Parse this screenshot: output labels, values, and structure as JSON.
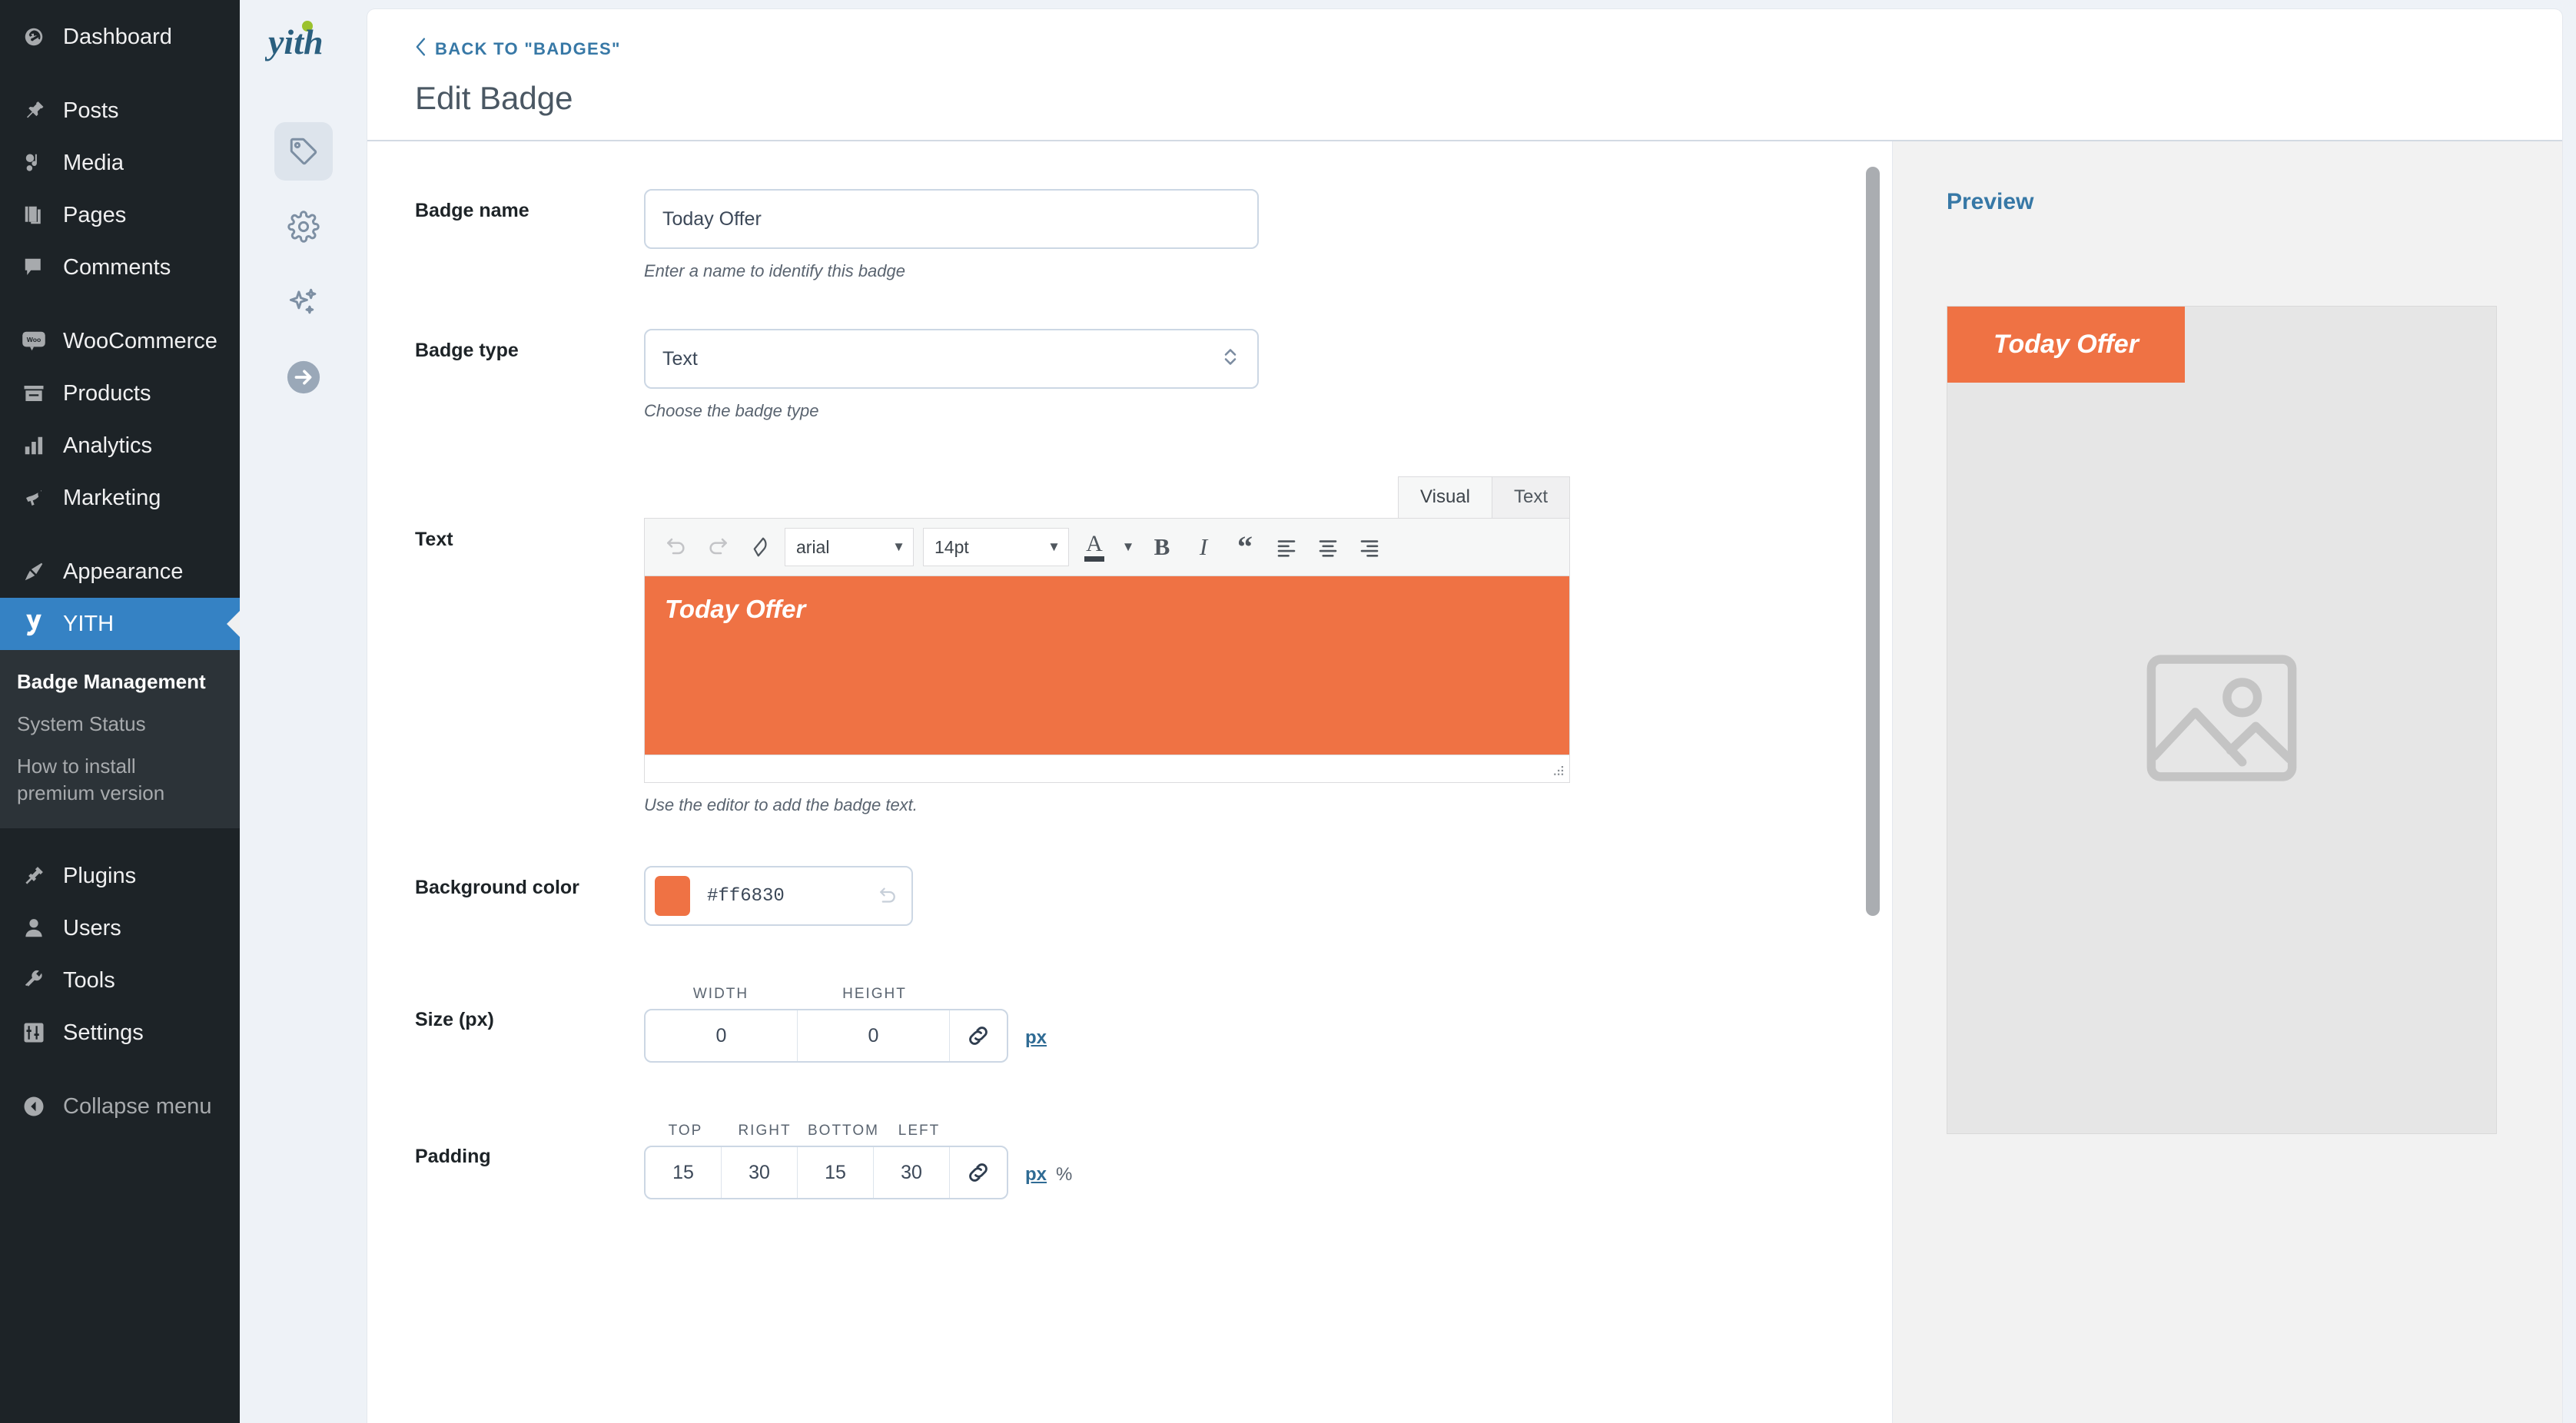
{
  "wp_sidebar": {
    "items": [
      {
        "label": "Dashboard",
        "icon": "dashboard-icon"
      },
      {
        "label": "Posts",
        "icon": "pin-icon"
      },
      {
        "label": "Media",
        "icon": "media-icon"
      },
      {
        "label": "Pages",
        "icon": "pages-icon"
      },
      {
        "label": "Comments",
        "icon": "comment-icon"
      },
      {
        "label": "WooCommerce",
        "icon": "woo-icon"
      },
      {
        "label": "Products",
        "icon": "products-icon"
      },
      {
        "label": "Analytics",
        "icon": "analytics-icon"
      },
      {
        "label": "Marketing",
        "icon": "megaphone-icon"
      },
      {
        "label": "Appearance",
        "icon": "brush-icon"
      },
      {
        "label": "YITH",
        "icon": "yith-icon"
      },
      {
        "label": "Plugins",
        "icon": "plug-icon"
      },
      {
        "label": "Users",
        "icon": "user-icon"
      },
      {
        "label": "Tools",
        "icon": "wrench-icon"
      },
      {
        "label": "Settings",
        "icon": "sliders-icon"
      },
      {
        "label": "Collapse menu",
        "icon": "collapse-icon"
      }
    ],
    "yith_submenu": [
      {
        "label": "Badge Management",
        "current": true
      },
      {
        "label": "System Status",
        "current": false
      },
      {
        "label": "How to install premium version",
        "current": false
      }
    ],
    "active_item": "YITH"
  },
  "rail": {
    "logo": "yith",
    "buttons": [
      {
        "name": "tag-icon",
        "active": true
      },
      {
        "name": "gear-icon",
        "active": false
      },
      {
        "name": "sparkles-icon",
        "active": false
      },
      {
        "name": "arrow-right-circle-icon",
        "active": false
      }
    ]
  },
  "header": {
    "back_label": "BACK TO \"BADGES\"",
    "title": "Edit Badge"
  },
  "form": {
    "badge_name": {
      "label": "Badge name",
      "value": "Today Offer",
      "placeholder": "",
      "description": "Enter a name to identify this badge"
    },
    "badge_type": {
      "label": "Badge type",
      "value": "Text",
      "description": "Choose the badge type"
    },
    "text": {
      "label": "Text",
      "description": "Use the editor to add the badge text.",
      "tabs": [
        {
          "label": "Visual",
          "active": true
        },
        {
          "label": "Text",
          "active": false
        }
      ],
      "toolbar": {
        "undo": "undo-icon",
        "redo": "redo-icon",
        "clear_formatting": "eraser-icon",
        "font_family": "arial",
        "font_size": "14pt",
        "text_color": "A",
        "bold": "B",
        "italic": "I",
        "blockquote": "“",
        "align_left": "align-left-icon",
        "align_center": "align-center-icon",
        "align_right": "align-right-icon"
      },
      "content": "Today Offer",
      "content_bg": "#ef7244"
    },
    "background_color": {
      "label": "Background color",
      "hex": "#ff6830",
      "swatch": "#ef7244"
    },
    "size": {
      "label": "Size (px)",
      "headers": [
        "WIDTH",
        "HEIGHT"
      ],
      "values": [
        "0",
        "0"
      ],
      "link_icon": "link-icon",
      "units": [
        {
          "label": "px",
          "selected": true
        }
      ]
    },
    "padding": {
      "label": "Padding",
      "headers": [
        "TOP",
        "RIGHT",
        "BOTTOM",
        "LEFT"
      ],
      "values": [
        "15",
        "30",
        "15",
        "30"
      ],
      "link_icon": "link-icon",
      "units": [
        {
          "label": "px",
          "selected": true
        },
        {
          "label": "%",
          "selected": false
        }
      ]
    }
  },
  "preview": {
    "title": "Preview",
    "badge_text": "Today Offer",
    "badge_color": "#ef7244",
    "placeholder_icon": "image-placeholder-icon"
  },
  "colors": {
    "accent_blue": "#3582c4",
    "link_blue": "#3778a6",
    "badge_orange": "#ef7244",
    "sidebar_bg": "#1d2327"
  }
}
